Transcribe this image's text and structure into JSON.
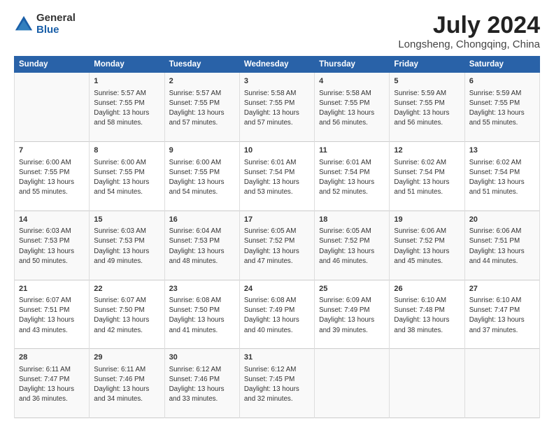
{
  "logo": {
    "general": "General",
    "blue": "Blue"
  },
  "title": "July 2024",
  "subtitle": "Longsheng, Chongqing, China",
  "columns": [
    "Sunday",
    "Monday",
    "Tuesday",
    "Wednesday",
    "Thursday",
    "Friday",
    "Saturday"
  ],
  "weeks": [
    [
      {
        "day": "",
        "info": ""
      },
      {
        "day": "1",
        "info": "Sunrise: 5:57 AM\nSunset: 7:55 PM\nDaylight: 13 hours\nand 58 minutes."
      },
      {
        "day": "2",
        "info": "Sunrise: 5:57 AM\nSunset: 7:55 PM\nDaylight: 13 hours\nand 57 minutes."
      },
      {
        "day": "3",
        "info": "Sunrise: 5:58 AM\nSunset: 7:55 PM\nDaylight: 13 hours\nand 57 minutes."
      },
      {
        "day": "4",
        "info": "Sunrise: 5:58 AM\nSunset: 7:55 PM\nDaylight: 13 hours\nand 56 minutes."
      },
      {
        "day": "5",
        "info": "Sunrise: 5:59 AM\nSunset: 7:55 PM\nDaylight: 13 hours\nand 56 minutes."
      },
      {
        "day": "6",
        "info": "Sunrise: 5:59 AM\nSunset: 7:55 PM\nDaylight: 13 hours\nand 55 minutes."
      }
    ],
    [
      {
        "day": "7",
        "info": "Sunrise: 6:00 AM\nSunset: 7:55 PM\nDaylight: 13 hours\nand 55 minutes."
      },
      {
        "day": "8",
        "info": "Sunrise: 6:00 AM\nSunset: 7:55 PM\nDaylight: 13 hours\nand 54 minutes."
      },
      {
        "day": "9",
        "info": "Sunrise: 6:00 AM\nSunset: 7:55 PM\nDaylight: 13 hours\nand 54 minutes."
      },
      {
        "day": "10",
        "info": "Sunrise: 6:01 AM\nSunset: 7:54 PM\nDaylight: 13 hours\nand 53 minutes."
      },
      {
        "day": "11",
        "info": "Sunrise: 6:01 AM\nSunset: 7:54 PM\nDaylight: 13 hours\nand 52 minutes."
      },
      {
        "day": "12",
        "info": "Sunrise: 6:02 AM\nSunset: 7:54 PM\nDaylight: 13 hours\nand 51 minutes."
      },
      {
        "day": "13",
        "info": "Sunrise: 6:02 AM\nSunset: 7:54 PM\nDaylight: 13 hours\nand 51 minutes."
      }
    ],
    [
      {
        "day": "14",
        "info": "Sunrise: 6:03 AM\nSunset: 7:53 PM\nDaylight: 13 hours\nand 50 minutes."
      },
      {
        "day": "15",
        "info": "Sunrise: 6:03 AM\nSunset: 7:53 PM\nDaylight: 13 hours\nand 49 minutes."
      },
      {
        "day": "16",
        "info": "Sunrise: 6:04 AM\nSunset: 7:53 PM\nDaylight: 13 hours\nand 48 minutes."
      },
      {
        "day": "17",
        "info": "Sunrise: 6:05 AM\nSunset: 7:52 PM\nDaylight: 13 hours\nand 47 minutes."
      },
      {
        "day": "18",
        "info": "Sunrise: 6:05 AM\nSunset: 7:52 PM\nDaylight: 13 hours\nand 46 minutes."
      },
      {
        "day": "19",
        "info": "Sunrise: 6:06 AM\nSunset: 7:52 PM\nDaylight: 13 hours\nand 45 minutes."
      },
      {
        "day": "20",
        "info": "Sunrise: 6:06 AM\nSunset: 7:51 PM\nDaylight: 13 hours\nand 44 minutes."
      }
    ],
    [
      {
        "day": "21",
        "info": "Sunrise: 6:07 AM\nSunset: 7:51 PM\nDaylight: 13 hours\nand 43 minutes."
      },
      {
        "day": "22",
        "info": "Sunrise: 6:07 AM\nSunset: 7:50 PM\nDaylight: 13 hours\nand 42 minutes."
      },
      {
        "day": "23",
        "info": "Sunrise: 6:08 AM\nSunset: 7:50 PM\nDaylight: 13 hours\nand 41 minutes."
      },
      {
        "day": "24",
        "info": "Sunrise: 6:08 AM\nSunset: 7:49 PM\nDaylight: 13 hours\nand 40 minutes."
      },
      {
        "day": "25",
        "info": "Sunrise: 6:09 AM\nSunset: 7:49 PM\nDaylight: 13 hours\nand 39 minutes."
      },
      {
        "day": "26",
        "info": "Sunrise: 6:10 AM\nSunset: 7:48 PM\nDaylight: 13 hours\nand 38 minutes."
      },
      {
        "day": "27",
        "info": "Sunrise: 6:10 AM\nSunset: 7:47 PM\nDaylight: 13 hours\nand 37 minutes."
      }
    ],
    [
      {
        "day": "28",
        "info": "Sunrise: 6:11 AM\nSunset: 7:47 PM\nDaylight: 13 hours\nand 36 minutes."
      },
      {
        "day": "29",
        "info": "Sunrise: 6:11 AM\nSunset: 7:46 PM\nDaylight: 13 hours\nand 34 minutes."
      },
      {
        "day": "30",
        "info": "Sunrise: 6:12 AM\nSunset: 7:46 PM\nDaylight: 13 hours\nand 33 minutes."
      },
      {
        "day": "31",
        "info": "Sunrise: 6:12 AM\nSunset: 7:45 PM\nDaylight: 13 hours\nand 32 minutes."
      },
      {
        "day": "",
        "info": ""
      },
      {
        "day": "",
        "info": ""
      },
      {
        "day": "",
        "info": ""
      }
    ]
  ]
}
